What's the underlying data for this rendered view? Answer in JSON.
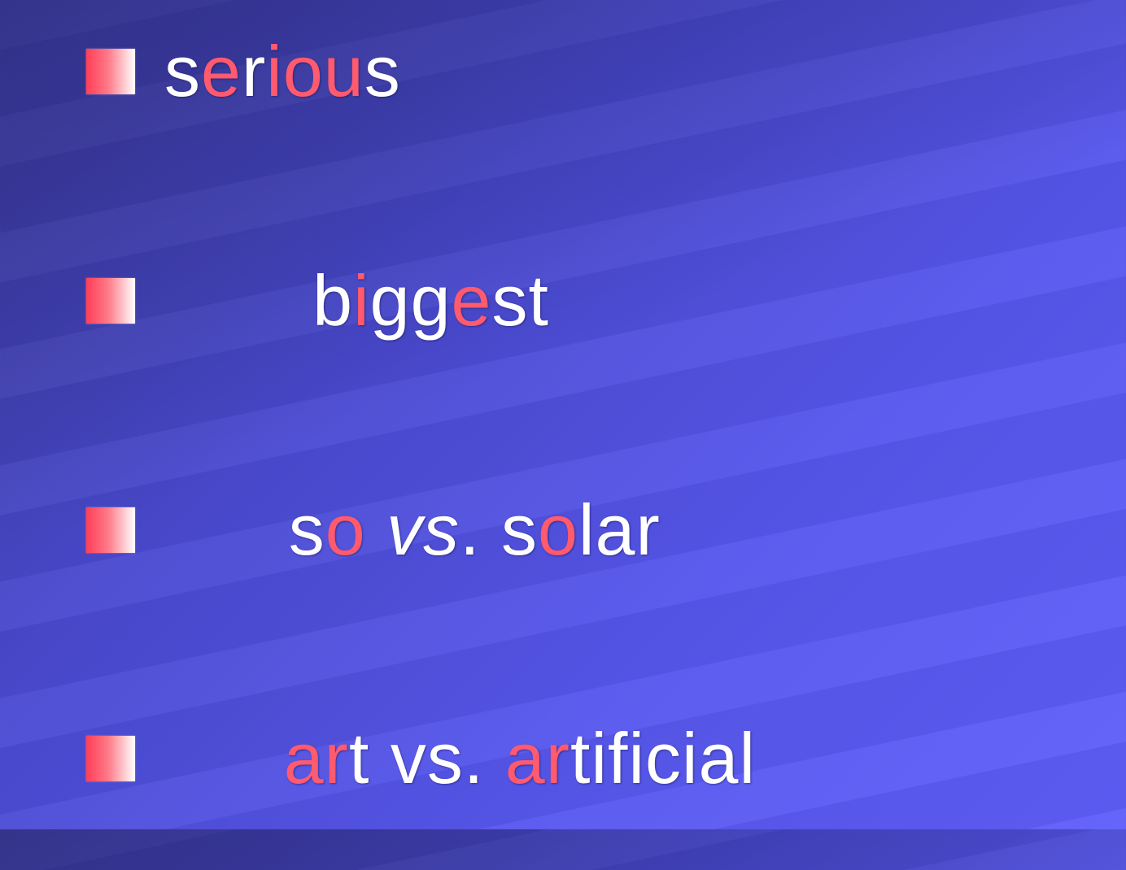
{
  "slide": {
    "items": [
      {
        "segments": [
          {
            "text": "s",
            "highlight": false,
            "italic": false
          },
          {
            "text": "e",
            "highlight": true,
            "italic": false
          },
          {
            "text": "r",
            "highlight": false,
            "italic": false
          },
          {
            "text": "iou",
            "highlight": true,
            "italic": false
          },
          {
            "text": "s",
            "highlight": false,
            "italic": false
          }
        ]
      },
      {
        "segments": [
          {
            "text": " b",
            "highlight": false,
            "italic": false
          },
          {
            "text": "i",
            "highlight": true,
            "italic": false
          },
          {
            "text": "gg",
            "highlight": false,
            "italic": false
          },
          {
            "text": "e",
            "highlight": true,
            "italic": false
          },
          {
            "text": "st",
            "highlight": false,
            "italic": false
          }
        ]
      },
      {
        "segments": [
          {
            "text": "s",
            "highlight": false,
            "italic": false
          },
          {
            "text": "o",
            "highlight": true,
            "italic": false
          },
          {
            "text": " ",
            "highlight": false,
            "italic": false
          },
          {
            "text": "vs",
            "highlight": false,
            "italic": true
          },
          {
            "text": ". s",
            "highlight": false,
            "italic": false
          },
          {
            "text": "o",
            "highlight": true,
            "italic": false
          },
          {
            "text": "lar",
            "highlight": false,
            "italic": false
          }
        ]
      },
      {
        "segments": [
          {
            "text": "ar",
            "highlight": true,
            "italic": false
          },
          {
            "text": "t vs. ",
            "highlight": false,
            "italic": false
          },
          {
            "text": "ar",
            "highlight": true,
            "italic": false
          },
          {
            "text": "tificial",
            "highlight": false,
            "italic": false
          }
        ]
      }
    ],
    "colors": {
      "text": "#ffffff",
      "highlight": "#ff5a6e",
      "background": "#5050e0"
    }
  }
}
